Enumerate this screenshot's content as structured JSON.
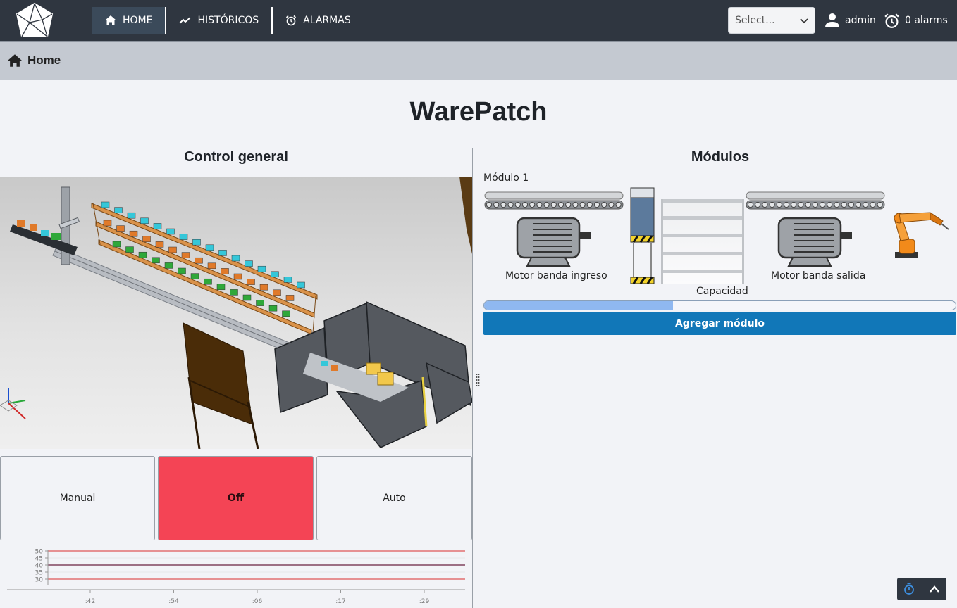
{
  "nav": {
    "items": [
      {
        "label": "HOME",
        "icon": "home-icon",
        "active": true
      },
      {
        "label": "HISTÓRICOS",
        "icon": "trend-icon",
        "active": false
      },
      {
        "label": "ALARMAS",
        "icon": "alarm-clock-icon",
        "active": false
      }
    ],
    "select_placeholder": "Select...",
    "user": "admin",
    "alarms": "0 alarms"
  },
  "breadcrumb": {
    "label": "Home"
  },
  "page": {
    "title": "WarePatch"
  },
  "control": {
    "title": "Control general",
    "modes": {
      "manual": "Manual",
      "off": "Off",
      "auto": "Auto"
    },
    "active_mode": "Off",
    "trend": {
      "y_ticks": [
        "50",
        "45",
        "40",
        "35",
        "30"
      ],
      "x_ticks": [
        ":42",
        ":54",
        ":06",
        ":17",
        ":29"
      ]
    }
  },
  "modules": {
    "title": "Módulos",
    "module_name": "Módulo 1",
    "motor_in": "Motor banda ingreso",
    "motor_out": "Motor banda salida",
    "capacity": "Capacidad",
    "capacity_fill": 0.4,
    "add_button": "Agregar módulo"
  },
  "colors": {
    "topbar": "#2f3640",
    "off": "#f44455",
    "primary": "#1177b8",
    "progress": "#8fb8f0"
  }
}
